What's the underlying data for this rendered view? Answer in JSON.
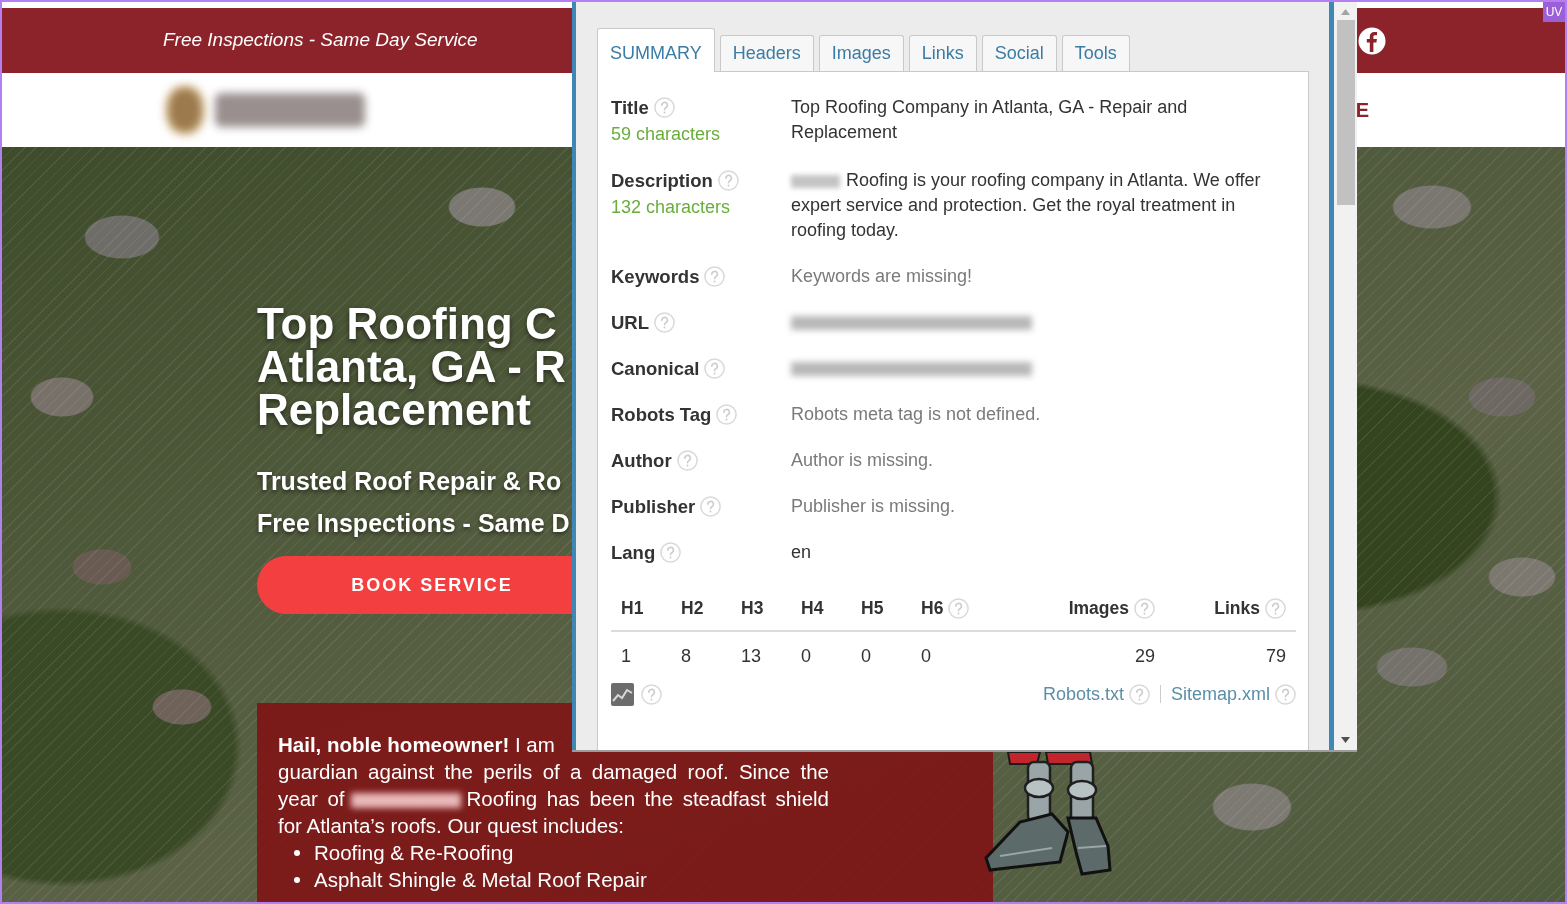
{
  "page": {
    "top_bar": {
      "tagline": "Free Inspections - Same Day Service"
    },
    "nav": {
      "partial_link": "E"
    },
    "hero": {
      "heading_lines": [
        "Top Roofing C",
        "Atlanta, GA - R",
        "Replacement"
      ],
      "subheading_lines": [
        "Trusted Roof Repair & Ro",
        "Free Inspections - Same D"
      ],
      "button": "BOOK SERVICE"
    },
    "intro": {
      "first_line": "**Hail, noble homeowner!** I am",
      "text_before_redaction": "guardian against the perils of a damaged roof. Since the year of",
      "text_after_redaction": "Roofing has been the steadfast shield for Atlanta’s roofs. Our quest includes:",
      "list": [
        "Roofing & Re-Roofing",
        "Asphalt Shingle & Metal Roof Repair"
      ]
    }
  },
  "corner_badge": "UV",
  "popup": {
    "tabs": [
      {
        "label": "SUMMARY",
        "selected": true
      },
      {
        "label": "Headers",
        "selected": false
      },
      {
        "label": "Images",
        "selected": false
      },
      {
        "label": "Links",
        "selected": false
      },
      {
        "label": "Social",
        "selected": false
      },
      {
        "label": "Tools",
        "selected": false
      }
    ],
    "fields": [
      {
        "label": "Title",
        "count": "59 characters",
        "kind": "text",
        "value": "Top Roofing Company in Atlanta, GA - Repair and Replacement",
        "missing": false
      },
      {
        "label": "Description",
        "count": "132 characters",
        "kind": "text",
        "prefix_redacted": true,
        "value": "Roofing is your roofing company in Atlanta. We offer expert service and protection. Get the royal treatment in roofing today.",
        "missing": false
      },
      {
        "label": "Keywords",
        "kind": "text",
        "value": "Keywords are missing!",
        "missing": true
      },
      {
        "label": "URL",
        "kind": "redacted"
      },
      {
        "label": "Canonical",
        "kind": "redacted"
      },
      {
        "label": "Robots Tag",
        "kind": "text",
        "value": "Robots meta tag is not defined.",
        "missing": true
      },
      {
        "label": "Author",
        "kind": "text",
        "value": "Author is missing.",
        "missing": true
      },
      {
        "label": "Publisher",
        "kind": "text",
        "value": "Publisher is missing.",
        "missing": true
      },
      {
        "label": "Lang",
        "kind": "text",
        "value": "en",
        "missing": false
      }
    ],
    "headings": {
      "columns": [
        {
          "label": "H1",
          "help": false
        },
        {
          "label": "H2",
          "help": false
        },
        {
          "label": "H3",
          "help": false
        },
        {
          "label": "H4",
          "help": false
        },
        {
          "label": "H5",
          "help": false
        },
        {
          "label": "H6",
          "help": true
        },
        {
          "label": "Images",
          "help": true
        },
        {
          "label": "Links",
          "help": true
        }
      ],
      "values": [
        "1",
        "8",
        "13",
        "0",
        "0",
        "0",
        "29",
        "79"
      ]
    },
    "footer_links": [
      "Robots.txt",
      "Sitemap.xml"
    ]
  }
}
